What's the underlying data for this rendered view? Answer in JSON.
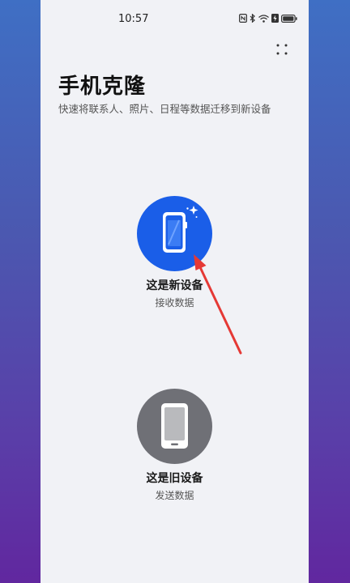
{
  "status_bar": {
    "time": "10:57",
    "icons": [
      "nfc-icon",
      "bluetooth-icon",
      "wifi-icon",
      "battery-saver-icon",
      "battery-icon"
    ]
  },
  "header": {
    "title": "手机克隆",
    "subtitle": "快速将联系人、照片、日程等数据迁移到新设备"
  },
  "options": {
    "new_device": {
      "title": "这是新设备",
      "subtitle": "接收数据",
      "icon": "new-phone-icon",
      "color": "#1a5ee8"
    },
    "old_device": {
      "title": "这是旧设备",
      "subtitle": "发送数据",
      "icon": "old-phone-icon",
      "color": "#6f7076"
    }
  },
  "annotation": {
    "arrow_color": "#e53935"
  }
}
